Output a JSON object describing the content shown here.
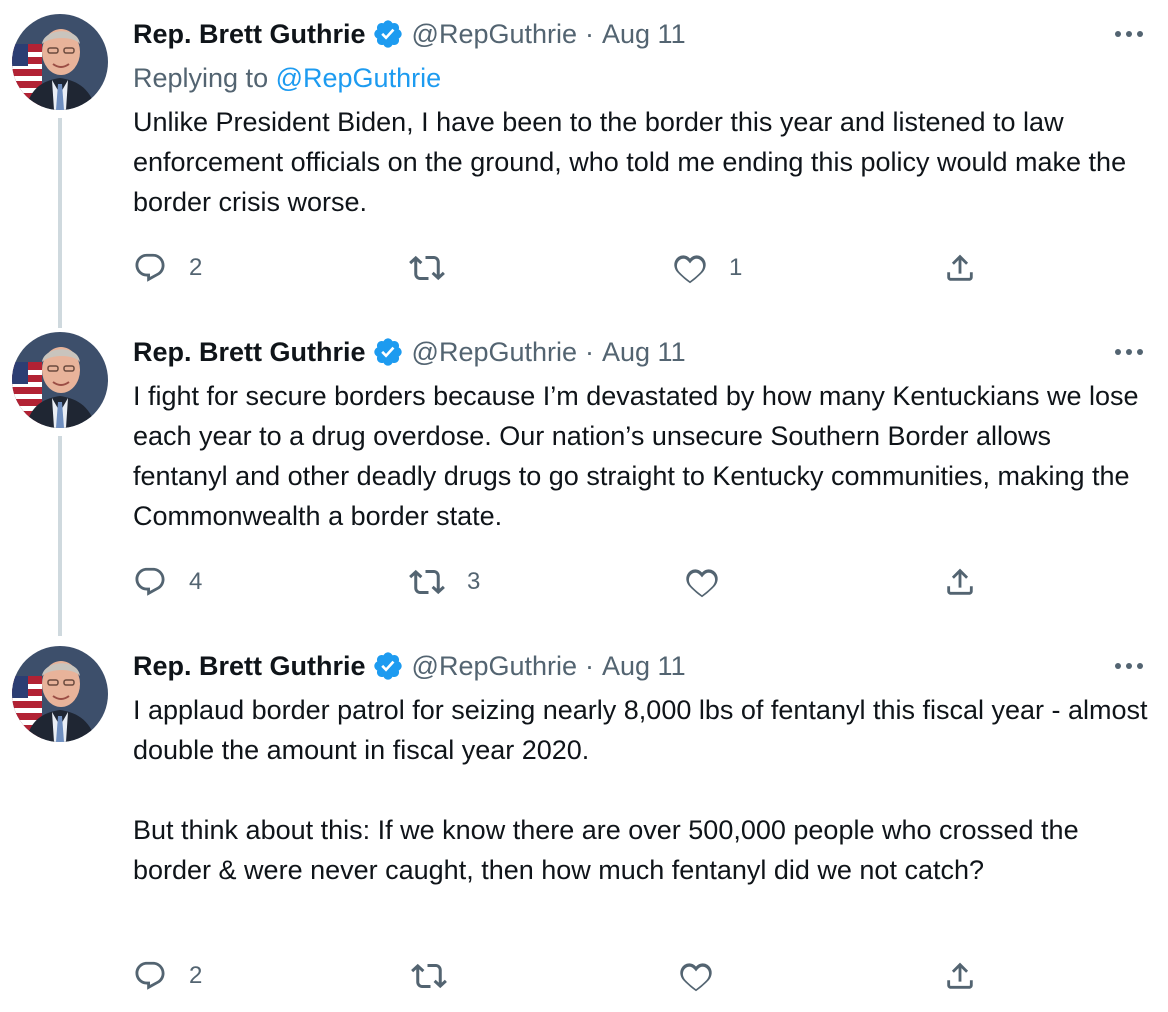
{
  "tweets": [
    {
      "name": "Rep. Brett Guthrie",
      "handle": "@RepGuthrie",
      "separator": "·",
      "date": "Aug 11",
      "replying_prefix": "Replying to",
      "replying_to": "@RepGuthrie",
      "paragraphs": [
        "Unlike President Biden, I have been to the border this year and listened to law enforcement officials on the ground, who told me ending this policy would make the border crisis worse."
      ],
      "replies": "2",
      "retweets": "",
      "likes": "1"
    },
    {
      "name": "Rep. Brett Guthrie",
      "handle": "@RepGuthrie",
      "separator": "·",
      "date": "Aug 11",
      "paragraphs": [
        "I fight for secure borders because I’m devastated by how many Kentuckians we lose each year to a drug overdose. Our nation’s unsecure Southern Border allows fentanyl and other deadly drugs to go straight to Kentucky communities, making the Commonwealth a border state."
      ],
      "replies": "4",
      "retweets": "3",
      "likes": ""
    },
    {
      "name": "Rep. Brett Guthrie",
      "handle": "@RepGuthrie",
      "separator": "·",
      "date": "Aug 11",
      "paragraphs": [
        "I applaud border patrol for seizing nearly 8,000 lbs of fentanyl this fiscal year - almost double the amount in fiscal year 2020.",
        "But think about this: If we know there are over 500,000 people who crossed the border & were never caught, then how much fentanyl did we not catch?"
      ],
      "replies": "2",
      "retweets": "",
      "likes": ""
    }
  ],
  "icons": {
    "verified": "verified-badge-icon",
    "more": "more-options-icon",
    "reply": "reply-icon",
    "retweet": "retweet-icon",
    "like": "like-icon",
    "share": "share-icon"
  },
  "colors": {
    "text": "#0f1419",
    "secondary": "#536471",
    "accent": "#1d9bf0",
    "thread_line": "#cfd9de"
  }
}
